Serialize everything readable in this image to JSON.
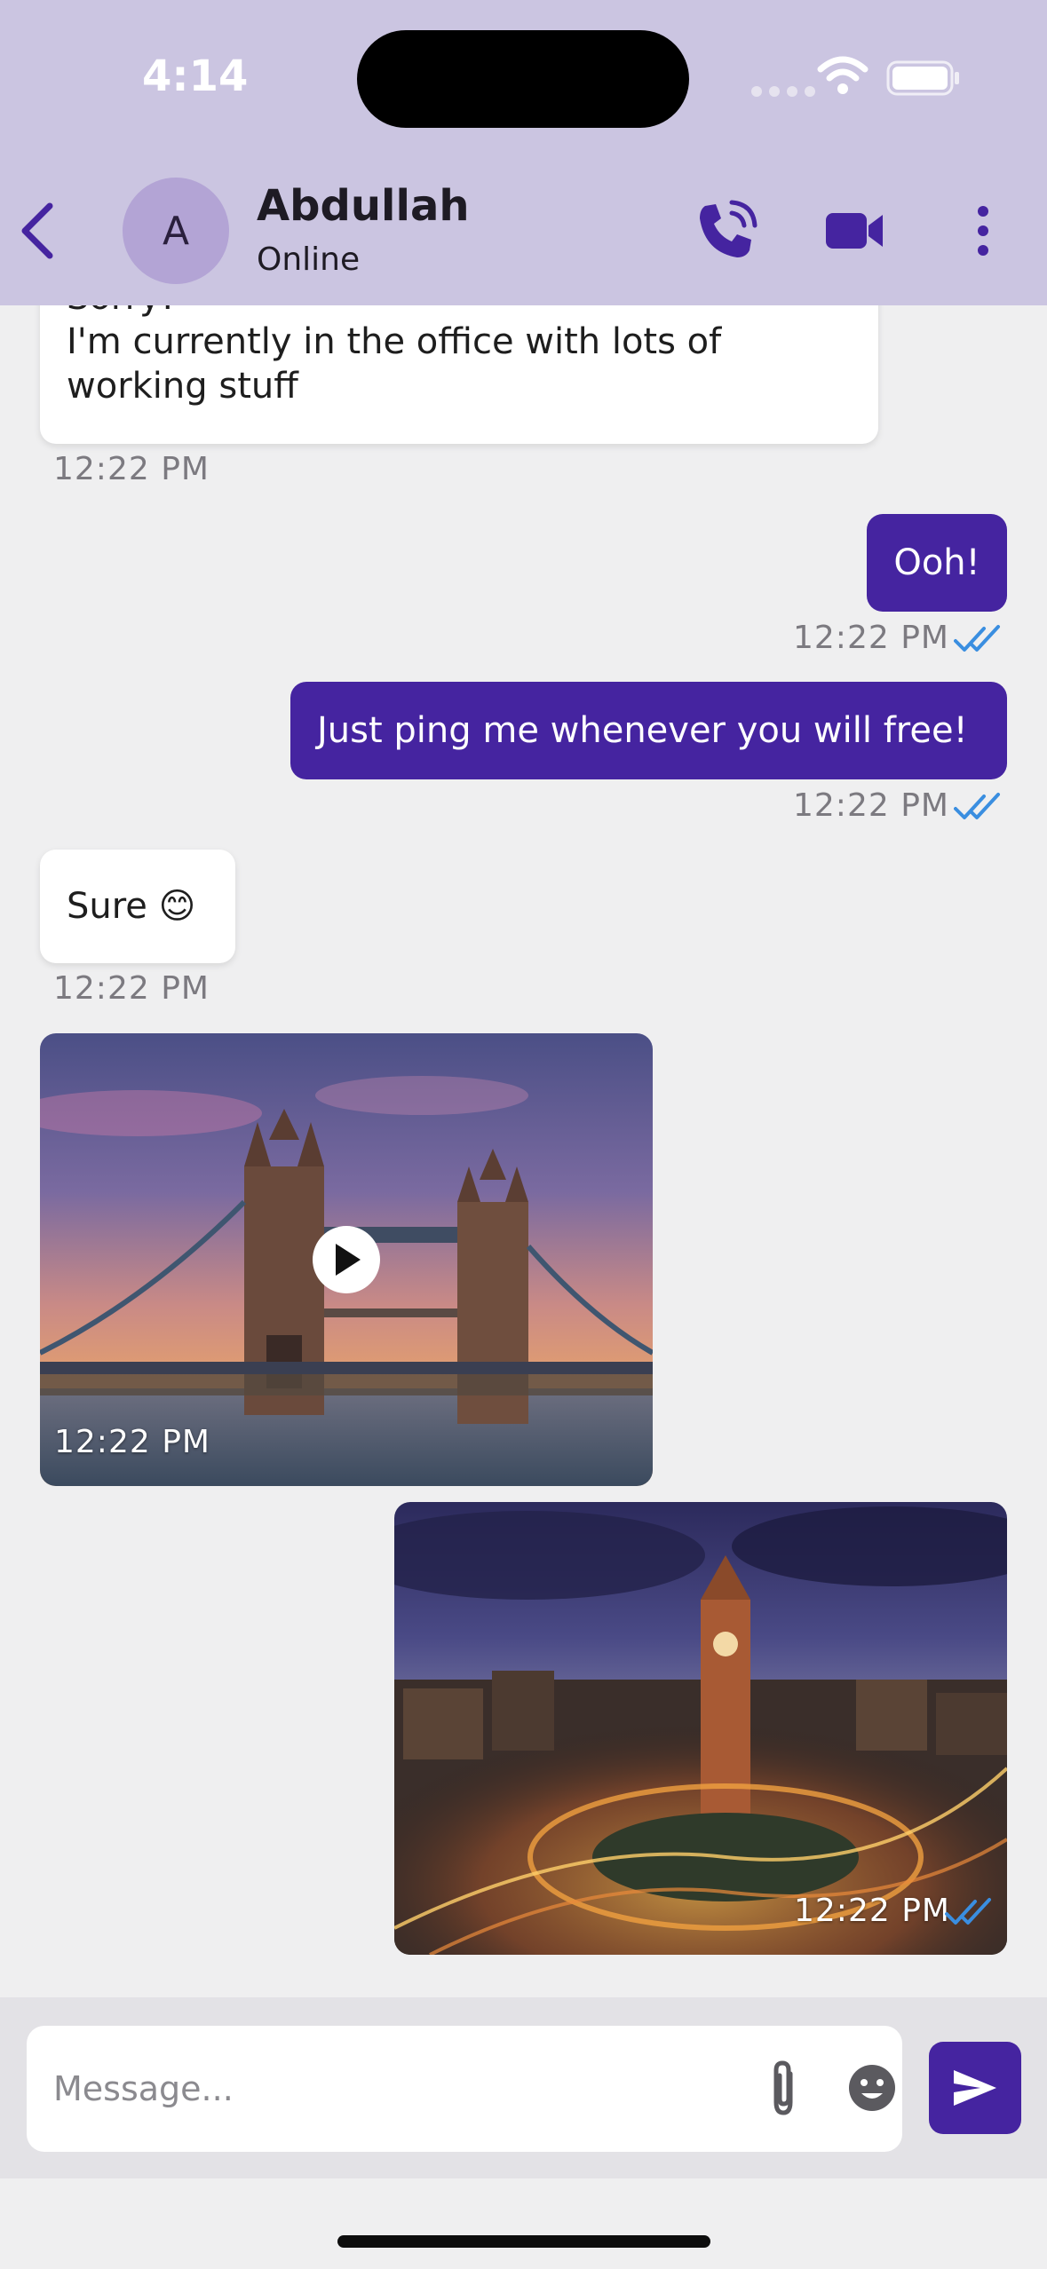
{
  "status_bar": {
    "time": "4:14"
  },
  "header": {
    "avatar_initial": "A",
    "contact_name": "Abdullah",
    "contact_status": "Online",
    "accent_color": "#4524a0",
    "background_color": "#cbc5e1"
  },
  "messages": [
    {
      "direction": "incoming",
      "lines": [
        "Sorry!",
        "I'm currently in the office with lots of",
        "working stuff"
      ],
      "time": "12:22 PM"
    },
    {
      "direction": "outgoing",
      "text": "Ooh!",
      "time": "12:22 PM",
      "status": "read"
    },
    {
      "direction": "outgoing",
      "text": "Just ping me whenever you will free!",
      "time": "12:22 PM",
      "status": "read"
    },
    {
      "direction": "incoming",
      "text": "Sure 😊",
      "time": "12:22 PM"
    },
    {
      "direction": "incoming",
      "type": "video",
      "thumbnail": "tower-bridge-sunset",
      "time": "12:22 PM"
    },
    {
      "direction": "outgoing",
      "type": "image",
      "thumbnail": "clock-tower-city-night",
      "time": "12:22 PM",
      "status": "read"
    }
  ],
  "composer": {
    "placeholder": "Message..."
  },
  "icons": {
    "back": "chevron-left-icon",
    "call": "phone-call-icon",
    "video": "video-camera-icon",
    "more": "more-vertical-icon",
    "attach": "paperclip-icon",
    "emoji": "emoji-icon",
    "send": "send-icon",
    "read": "double-check-icon",
    "play": "play-icon"
  },
  "colors": {
    "read_check": "#3a8ee0",
    "outgoing_bubble": "#4524a0",
    "incoming_bubble": "#ffffff"
  }
}
